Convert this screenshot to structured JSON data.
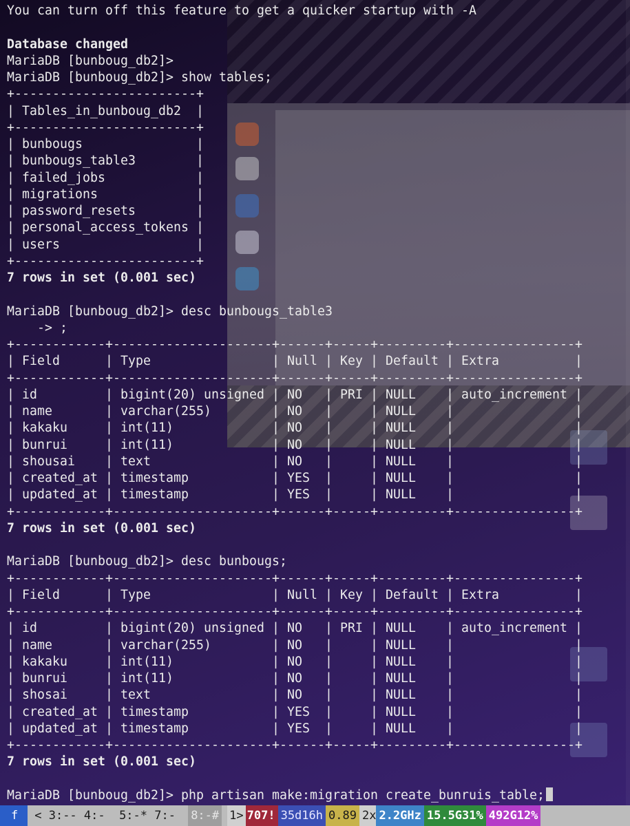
{
  "terminal": {
    "lines": [
      {
        "text": "You can turn off this feature to get a quicker startup with -A",
        "bold": false
      },
      {
        "text": "",
        "bold": false
      },
      {
        "text": "Database changed",
        "bold": true
      },
      {
        "text": "MariaDB [bunboug_db2]>",
        "bold": false
      },
      {
        "text": "MariaDB [bunboug_db2]> show tables;",
        "bold": false
      },
      {
        "text": "+------------------------+",
        "bold": false
      },
      {
        "text": "| Tables_in_bunboug_db2  |",
        "bold": false
      },
      {
        "text": "+------------------------+",
        "bold": false
      },
      {
        "text": "| bunbougs               |",
        "bold": false
      },
      {
        "text": "| bunbougs_table3        |",
        "bold": false
      },
      {
        "text": "| failed_jobs            |",
        "bold": false
      },
      {
        "text": "| migrations             |",
        "bold": false
      },
      {
        "text": "| password_resets        |",
        "bold": false
      },
      {
        "text": "| personal_access_tokens |",
        "bold": false
      },
      {
        "text": "| users                  |",
        "bold": false
      },
      {
        "text": "+------------------------+",
        "bold": false
      },
      {
        "text": "7 rows in set (0.001 sec)",
        "bold": true
      },
      {
        "text": "",
        "bold": false
      },
      {
        "text": "MariaDB [bunboug_db2]> desc bunbougs_table3",
        "bold": false
      },
      {
        "text": "    -> ;",
        "bold": false
      },
      {
        "text": "+------------+---------------------+------+-----+---------+----------------+",
        "bold": false
      },
      {
        "text": "| Field      | Type                | Null | Key | Default | Extra          |",
        "bold": false
      },
      {
        "text": "+------------+---------------------+------+-----+---------+----------------+",
        "bold": false
      },
      {
        "text": "| id         | bigint(20) unsigned | NO   | PRI | NULL    | auto_increment |",
        "bold": false
      },
      {
        "text": "| name       | varchar(255)        | NO   |     | NULL    |                |",
        "bold": false
      },
      {
        "text": "| kakaku     | int(11)             | NO   |     | NULL    |                |",
        "bold": false
      },
      {
        "text": "| bunrui     | int(11)             | NO   |     | NULL    |                |",
        "bold": false
      },
      {
        "text": "| shousai    | text                | NO   |     | NULL    |                |",
        "bold": false
      },
      {
        "text": "| created_at | timestamp           | YES  |     | NULL    |                |",
        "bold": false
      },
      {
        "text": "| updated_at | timestamp           | YES  |     | NULL    |                |",
        "bold": false
      },
      {
        "text": "+------------+---------------------+------+-----+---------+----------------+",
        "bold": false
      },
      {
        "text": "7 rows in set (0.001 sec)",
        "bold": true
      },
      {
        "text": "",
        "bold": false
      },
      {
        "text": "MariaDB [bunboug_db2]> desc bunbougs;",
        "bold": false
      },
      {
        "text": "+------------+---------------------+------+-----+---------+----------------+",
        "bold": false
      },
      {
        "text": "| Field      | Type                | Null | Key | Default | Extra          |",
        "bold": false
      },
      {
        "text": "+------------+---------------------+------+-----+---------+----------------+",
        "bold": false
      },
      {
        "text": "| id         | bigint(20) unsigned | NO   | PRI | NULL    | auto_increment |",
        "bold": false
      },
      {
        "text": "| name       | varchar(255)        | NO   |     | NULL    |                |",
        "bold": false
      },
      {
        "text": "| kakaku     | int(11)             | NO   |     | NULL    |                |",
        "bold": false
      },
      {
        "text": "| bunrui     | int(11)             | NO   |     | NULL    |                |",
        "bold": false
      },
      {
        "text": "| shosai     | text                | NO   |     | NULL    |                |",
        "bold": false
      },
      {
        "text": "| created_at | timestamp           | YES  |     | NULL    |                |",
        "bold": false
      },
      {
        "text": "| updated_at | timestamp           | YES  |     | NULL    |                |",
        "bold": false
      },
      {
        "text": "+------------+---------------------+------+-----+---------+----------------+",
        "bold": false
      },
      {
        "text": "7 rows in set (0.001 sec)",
        "bold": true
      },
      {
        "text": "",
        "bold": false
      }
    ],
    "prompt_line": "MariaDB [bunboug_db2]> php artisan make:migration create_bunruis_table;"
  },
  "statusbar": {
    "session": "f",
    "windows": "< 3:-- 4:-  5:-* 7:- ",
    "current_window": "8:-#",
    "count_prefix": "1>",
    "count": "707!",
    "uptime": "35d16h",
    "load": "0.89",
    "cpu_count": "2x",
    "cpu_freq": "2.2GHz",
    "mem": "15.5G31%",
    "disk": "492G12%"
  },
  "colors": {
    "terminal_text": "#ececec",
    "session_bg": "#2a5ec8",
    "count_bg": "#a0283a",
    "uptime_bg": "#3b4fb4",
    "load_bg": "#c8b34a",
    "cpu_bg": "#3e84c8",
    "mem_bg": "#2f8a3c",
    "disk_bg": "#b43cc8"
  }
}
